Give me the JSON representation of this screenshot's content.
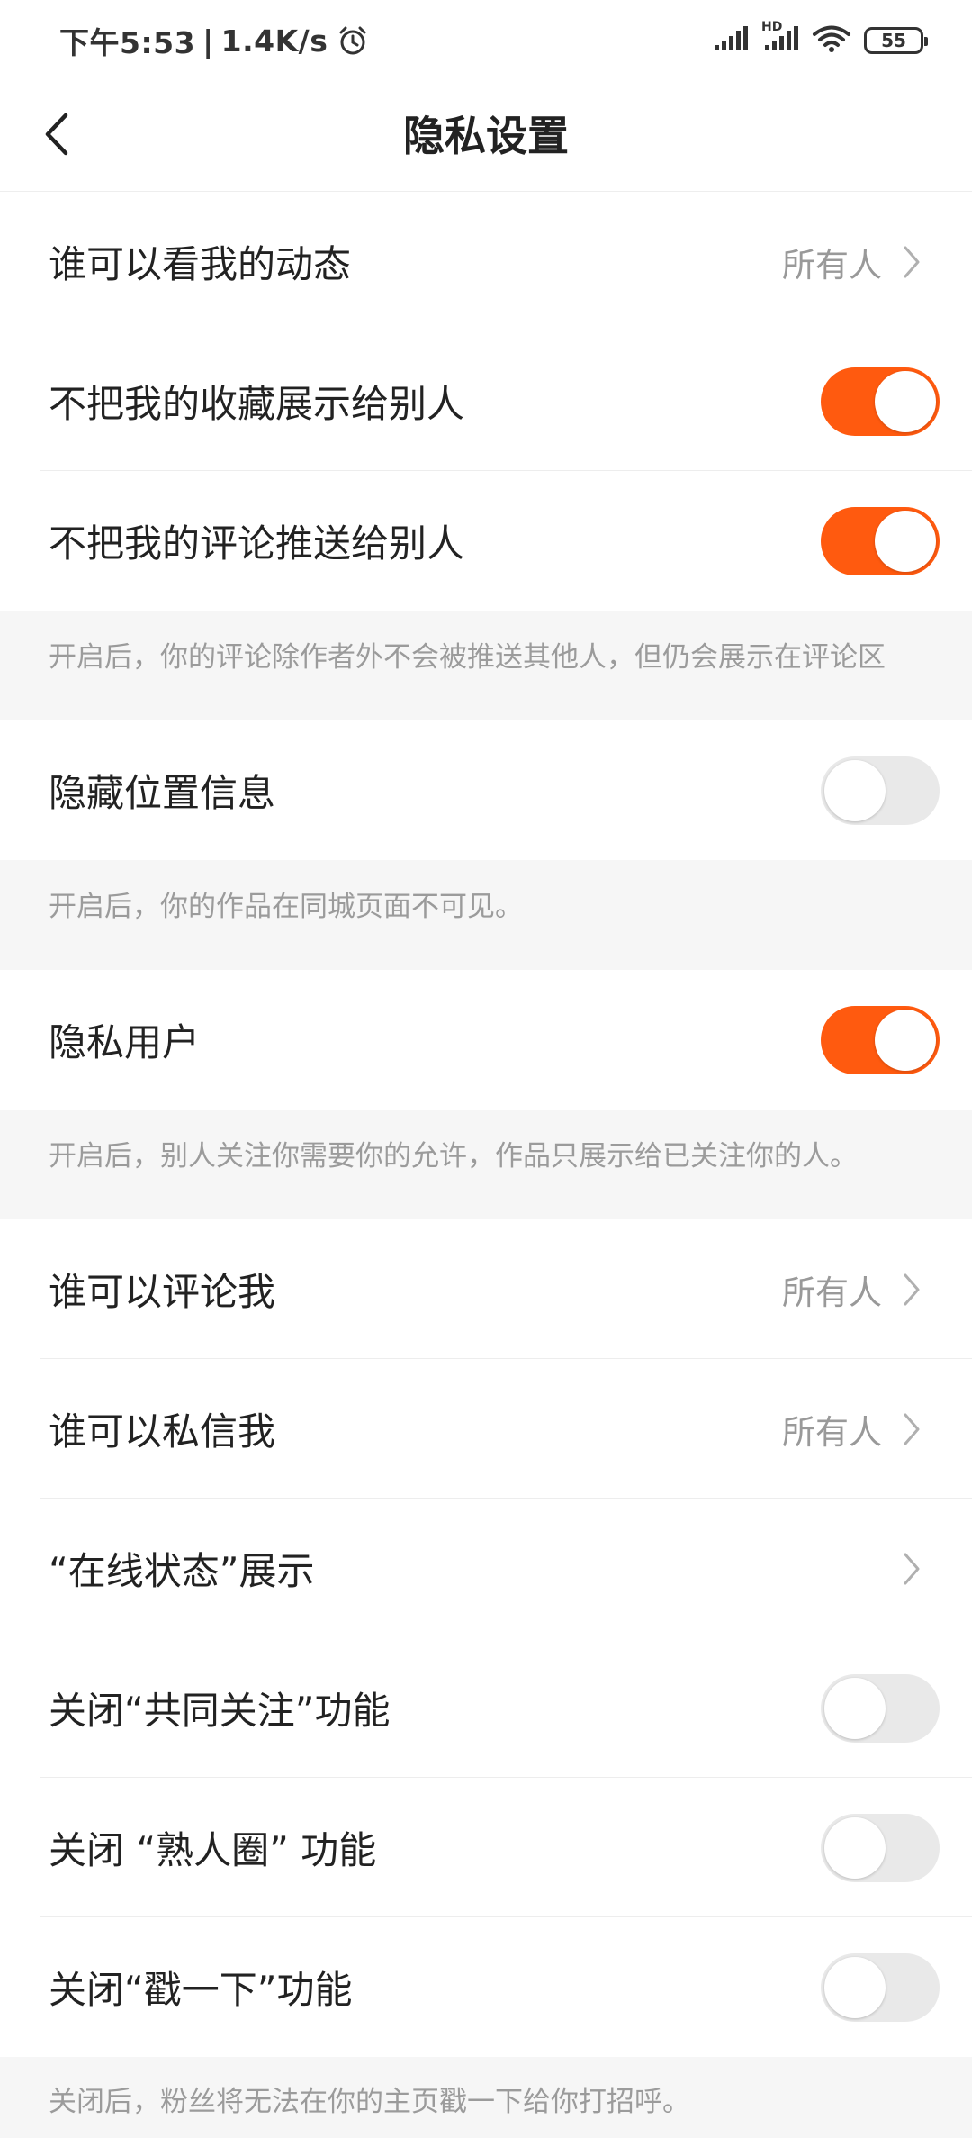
{
  "status_bar": {
    "time": "下午5:53",
    "speed": "1.4K/s",
    "separator": "|",
    "battery": "55",
    "hd_label": "HD"
  },
  "header": {
    "title": "隐私设置"
  },
  "rows": {
    "who_can_see_moments": {
      "label": "谁可以看我的动态",
      "value": "所有人"
    },
    "hide_favorites": {
      "label": "不把我的收藏展示给别人",
      "on": true
    },
    "hide_comments": {
      "label": "不把我的评论推送给别人",
      "on": true
    },
    "hide_comments_note": "开启后，你的评论除作者外不会被推送其他人，但仍会展示在评论区",
    "hide_location": {
      "label": "隐藏位置信息",
      "on": false
    },
    "hide_location_note": "开启后，你的作品在同城页面不可见。",
    "private_user": {
      "label": "隐私用户",
      "on": true
    },
    "private_user_note": "开启后，别人关注你需要你的允许，作品只展示给已关注你的人。",
    "who_can_comment": {
      "label": "谁可以评论我",
      "value": "所有人"
    },
    "who_can_message": {
      "label": "谁可以私信我",
      "value": "所有人"
    },
    "online_status": {
      "label": "“在线状态”展示"
    },
    "close_mutual_follow": {
      "label": "关闭“共同关注”功能",
      "on": false
    },
    "close_acquaintance": {
      "label": "关闭 “熟人圈” 功能",
      "on": false
    },
    "close_poke": {
      "label": "关闭“戳一下”功能",
      "on": false
    },
    "close_poke_note": "关闭后，粉丝将无法在你的主页戳一下给你打招呼。"
  },
  "colors": {
    "accent": "#ff5a0f",
    "toggle_off": "#e9e9e9",
    "note_bg": "#f6f6f6"
  },
  "icons": {
    "back": "chevron-left-icon",
    "alarm": "alarm-clock-icon",
    "signal": "signal-bars-icon",
    "wifi": "wifi-icon",
    "battery": "battery-icon",
    "chevron": "chevron-right-icon"
  }
}
